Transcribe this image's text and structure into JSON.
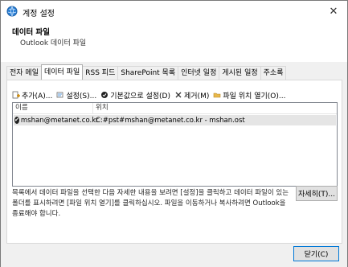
{
  "window": {
    "title": "계정 설정",
    "close_glyph": "✕"
  },
  "header": {
    "title": "데이터 파일",
    "subtitle": "Outlook 데이터 파일"
  },
  "tabs": [
    {
      "label": "전자 메일",
      "active": false
    },
    {
      "label": "데이터 파일",
      "active": true
    },
    {
      "label": "RSS 피드",
      "active": false
    },
    {
      "label": "SharePoint 목록",
      "active": false
    },
    {
      "label": "인터넷 일정",
      "active": false
    },
    {
      "label": "게시된 일정",
      "active": false
    },
    {
      "label": "주소록",
      "active": false
    }
  ],
  "toolbar": {
    "add_label": "추가(A)...",
    "settings_label": "설정(S)...",
    "default_label": "기본값으로 설정(D)",
    "remove_label": "제거(M)",
    "open_location_label": "파일 위치 열기(O)..."
  },
  "list": {
    "columns": [
      "이름",
      "위치"
    ],
    "rows": [
      {
        "name": "mshan@metanet.co.kr",
        "location": "C:#pst#mshan@metanet.co.kr - mshan.ost",
        "is_default": true
      }
    ]
  },
  "description": "목록에서 데이터 파일을 선택한 다음 자세한 내용을 보려면 [설정]을 클릭하고 데이터 파일이 있는 폴더를 표시하려면 [파일 위치 열기]를 클릭하십시오. 파일을 이동하거나 복사하려면 Outlook을 종료해야 합니다.",
  "buttons": {
    "detail_label": "자세히(T)...",
    "close_label": "닫기(C)"
  },
  "colors": {
    "dialog_bg": "#f0f0f0",
    "selected_row": "#e5e5e5",
    "focus_border": "#0078d7"
  }
}
